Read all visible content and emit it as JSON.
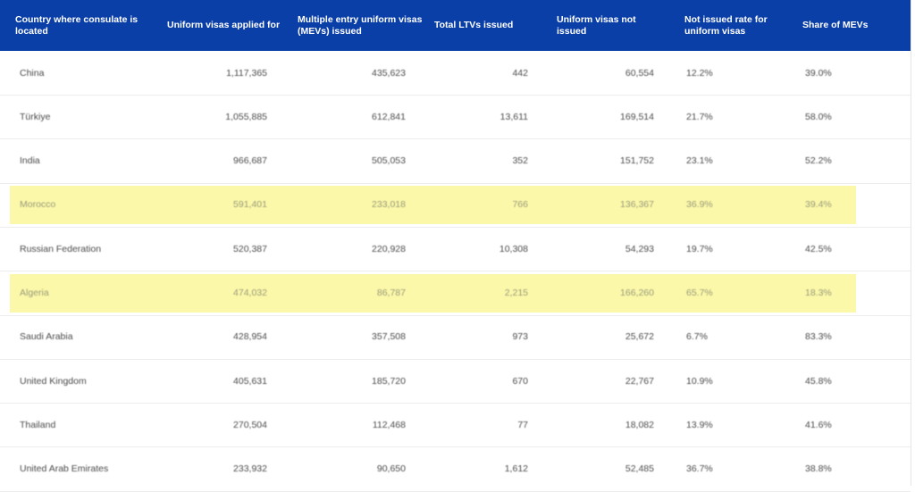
{
  "colors": {
    "header_bg": "#0b3fa8",
    "header_text": "#ffffff",
    "highlight": "#fbf8a9",
    "body_text": "#4a4a4a"
  },
  "headers": [
    "Country where consulate is located",
    "Uniform visas applied for",
    "Multiple entry uniform visas (MEVs) issued",
    "Total LTVs issued",
    "Uniform visas not issued",
    "Not issued rate for uniform visas",
    "Share of MEVs"
  ],
  "rows": [
    {
      "country": "China",
      "applied": "1,117,365",
      "mevs": "435,623",
      "ltvs": "442",
      "not_issued": "60,554",
      "not_issued_rate": "12.2%",
      "share_mevs": "39.0%",
      "highlighted": false
    },
    {
      "country": "Türkiye",
      "applied": "1,055,885",
      "mevs": "612,841",
      "ltvs": "13,611",
      "not_issued": "169,514",
      "not_issued_rate": "21.7%",
      "share_mevs": "58.0%",
      "highlighted": false
    },
    {
      "country": "India",
      "applied": "966,687",
      "mevs": "505,053",
      "ltvs": "352",
      "not_issued": "151,752",
      "not_issued_rate": "23.1%",
      "share_mevs": "52.2%",
      "highlighted": false
    },
    {
      "country": "Morocco",
      "applied": "591,401",
      "mevs": "233,018",
      "ltvs": "766",
      "not_issued": "136,367",
      "not_issued_rate": "36.9%",
      "share_mevs": "39.4%",
      "highlighted": true
    },
    {
      "country": "Russian Federation",
      "applied": "520,387",
      "mevs": "220,928",
      "ltvs": "10,308",
      "not_issued": "54,293",
      "not_issued_rate": "19.7%",
      "share_mevs": "42.5%",
      "highlighted": false
    },
    {
      "country": "Algeria",
      "applied": "474,032",
      "mevs": "86,787",
      "ltvs": "2,215",
      "not_issued": "166,260",
      "not_issued_rate": "65.7%",
      "share_mevs": "18.3%",
      "highlighted": true
    },
    {
      "country": "Saudi Arabia",
      "applied": "428,954",
      "mevs": "357,508",
      "ltvs": "973",
      "not_issued": "25,672",
      "not_issued_rate": "6.7%",
      "share_mevs": "83.3%",
      "highlighted": false
    },
    {
      "country": "United Kingdom",
      "applied": "405,631",
      "mevs": "185,720",
      "ltvs": "670",
      "not_issued": "22,767",
      "not_issued_rate": "10.9%",
      "share_mevs": "45.8%",
      "highlighted": false
    },
    {
      "country": "Thailand",
      "applied": "270,504",
      "mevs": "112,468",
      "ltvs": "77",
      "not_issued": "18,082",
      "not_issued_rate": "13.9%",
      "share_mevs": "41.6%",
      "highlighted": false
    },
    {
      "country": "United Arab Emirates",
      "applied": "233,932",
      "mevs": "90,650",
      "ltvs": "1,612",
      "not_issued": "52,485",
      "not_issued_rate": "36.7%",
      "share_mevs": "38.8%",
      "highlighted": false
    }
  ]
}
